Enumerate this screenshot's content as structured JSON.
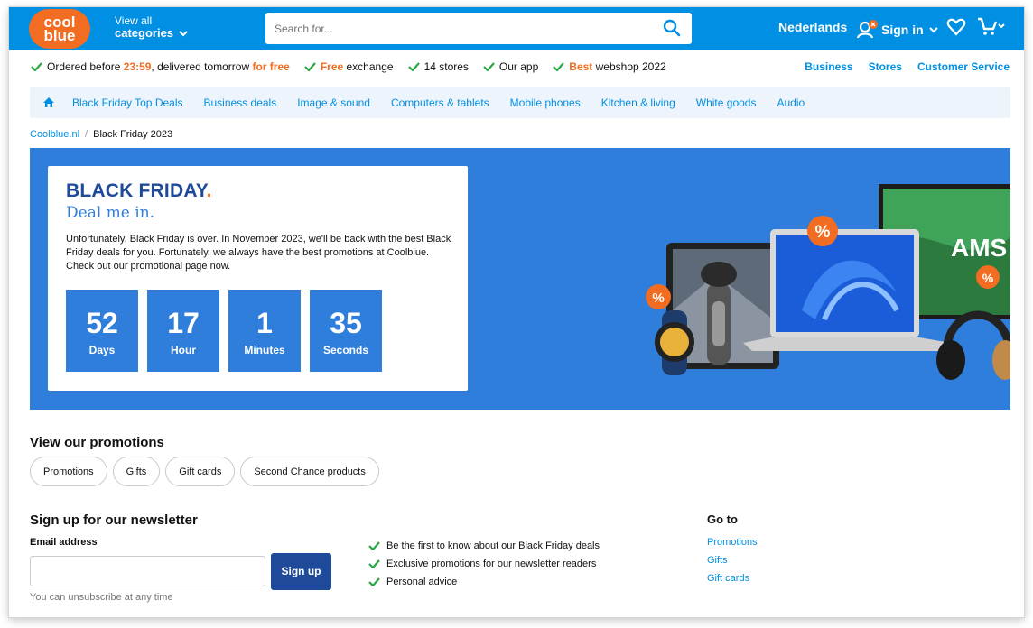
{
  "header": {
    "logo_line1": "cool",
    "logo_line2": "blue",
    "categories_top": "View all",
    "categories_bottom": "categories",
    "search_placeholder": "Search for...",
    "language": "Nederlands",
    "signin": "Sign in"
  },
  "usp": {
    "u1_pre": "Ordered before ",
    "u1_time": "23:59",
    "u1_mid": ", delivered tomorrow ",
    "u1_free": "for free",
    "u2_free": "Free",
    "u2_rest": " exchange",
    "u3": "14 stores",
    "u4": "Our app",
    "u5_best": "Best",
    "u5_rest": " webshop 2022"
  },
  "toplinks": [
    "Business",
    "Stores",
    "Customer Service"
  ],
  "catnav": [
    "Black Friday Top Deals",
    "Business deals",
    "Image & sound",
    "Computers & tablets",
    "Mobile phones",
    "Kitchen & living",
    "White goods",
    "Audio"
  ],
  "breadcrumb": {
    "home": "Coolblue.nl",
    "sep": "/",
    "current": "Black Friday 2023"
  },
  "hero": {
    "title": "BLACK FRIDAY",
    "title_dot": ".",
    "subtitle": "Deal me in.",
    "text": "Unfortunately, Black Friday is over. In November 2023, we'll be back with the best Black Friday deals for you. Fortunately, we always have the best promotions at Coolblue. Check out our promotional page now.",
    "counters": [
      {
        "value": "52",
        "label": "Days"
      },
      {
        "value": "17",
        "label": "Hour"
      },
      {
        "value": "1",
        "label": "Minutes"
      },
      {
        "value": "35",
        "label": "Seconds"
      }
    ],
    "art_badge": "%",
    "art_brand": "AMS"
  },
  "promotions": {
    "title": "View our promotions",
    "pills": [
      "Promotions",
      "Gifts",
      "Gift cards",
      "Second Chance products"
    ]
  },
  "newsletter": {
    "title": "Sign up for our newsletter",
    "email_label": "Email address",
    "button": "Sign up",
    "note": "You can unsubscribe at any time",
    "benefits": [
      "Be the first to know about our Black Friday deals",
      "Exclusive promotions for our newsletter readers",
      "Personal advice"
    ]
  },
  "goto": {
    "title": "Go to",
    "links": [
      "Promotions",
      "Gifts",
      "Gift cards"
    ]
  },
  "colors": {
    "brand_blue": "#0090e3",
    "orange": "#f26d21",
    "navy": "#1e4a99",
    "hero_blue": "#2f7edb"
  }
}
